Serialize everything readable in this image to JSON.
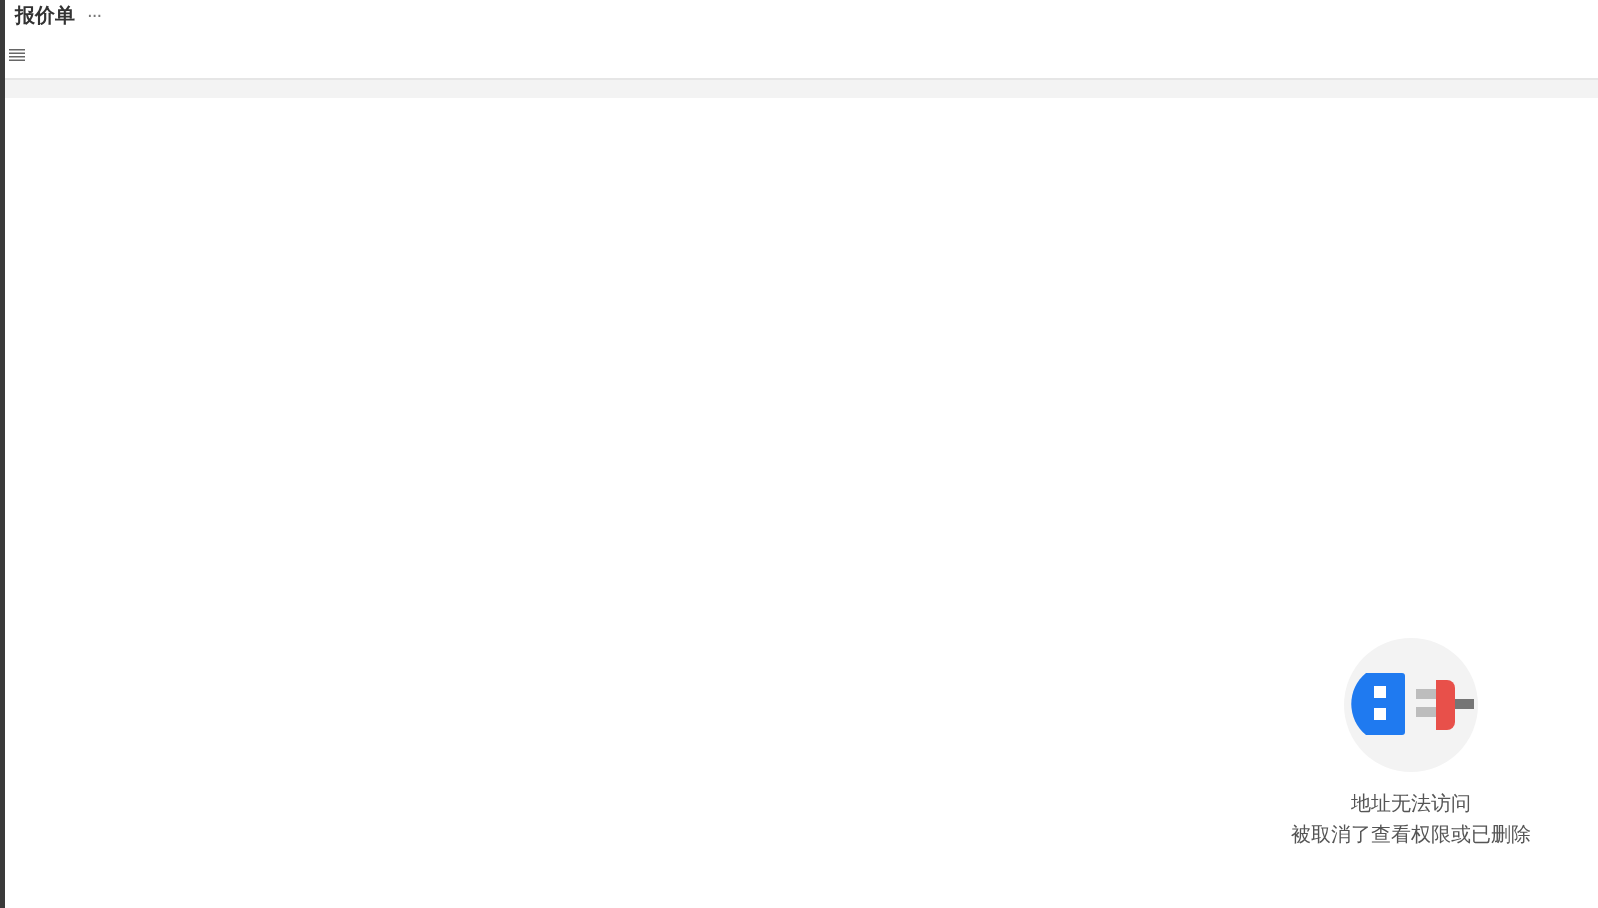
{
  "header": {
    "title": "报价单",
    "more": "···"
  },
  "empty_state": {
    "title": "地址无法访问",
    "message": "被取消了查看权限或已删除"
  }
}
